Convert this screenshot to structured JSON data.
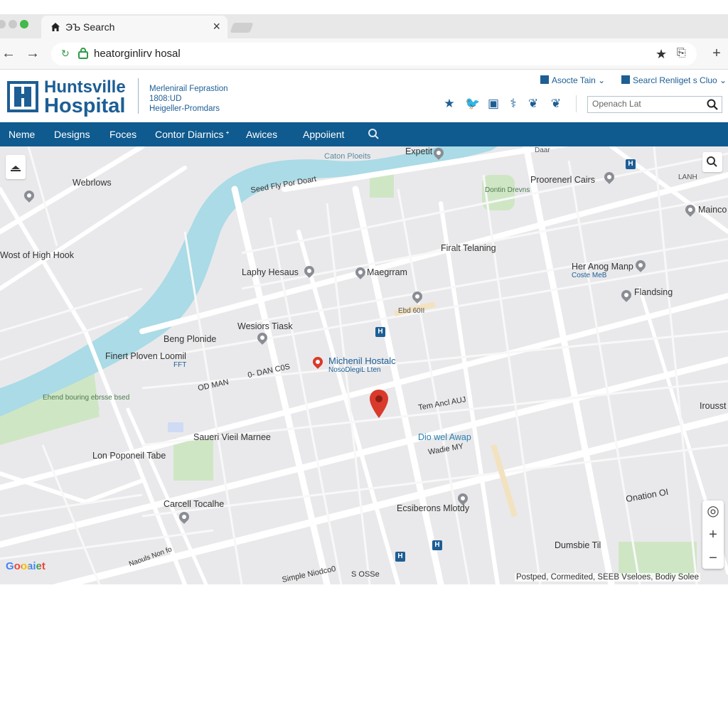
{
  "browser": {
    "tab_title": "ЭЪ Search",
    "tab_close": "×",
    "url": "heatorginlirv hosal",
    "back_icon": "back-arrow-icon",
    "forward_icon": "forward-arrow-icon",
    "back_glyph": "←",
    "forward_glyph": "→",
    "star_glyph": "★",
    "ext_glyph": "⎘",
    "plus_glyph": "+"
  },
  "site": {
    "logo_line1": "Huntsville",
    "logo_line2": "Hospital",
    "tagline": [
      "Merlenirail Feprastion",
      "1808:UD",
      "Heigeller-Promdars"
    ],
    "top_links": [
      "Asocte Tain ⌄",
      "Searcl Renliget s Cluo ⌄"
    ],
    "search_placeholder": "Openach Lat",
    "social_glyphs": [
      "★",
      "🐦",
      "▣",
      "⚕",
      "❦",
      "❦"
    ],
    "brand_color": "#1d5e95",
    "nav_color": "#0f5a8e"
  },
  "nav": {
    "items": [
      "Neme",
      "Designs",
      "Foces",
      "Contor Diarnics ᐩ",
      "Awices",
      "Appoiient"
    ]
  },
  "map": {
    "labels": [
      {
        "text": "Wost of High Hook"
      },
      {
        "text": "Webrlows"
      },
      {
        "text": "Seed Fly Por Doart"
      },
      {
        "text": "Caton Ploeits"
      },
      {
        "text": "Expetit"
      },
      {
        "text": "Proorenerl Cairs"
      },
      {
        "text": "Mainco"
      },
      {
        "text": "Laphy Hesaus"
      },
      {
        "text": "Maegrram"
      },
      {
        "text": "Firalt Telaning"
      },
      {
        "text": "Her Anog Manp"
      },
      {
        "text": "Coste MeB"
      },
      {
        "text": "Flandsing"
      },
      {
        "text": "Wesiors Tiask"
      },
      {
        "text": "Beng Plonide"
      },
      {
        "text": "Finert Ploven Loomil"
      },
      {
        "text": "FFT"
      },
      {
        "text": "Michenil Hostalc"
      },
      {
        "text": "NosoDlegiL Lten"
      },
      {
        "text": "Tem Ancl AUJ"
      },
      {
        "text": "Saueri Vieil Marnee"
      },
      {
        "text": "Dio wel Awap"
      },
      {
        "text": "Wadie MY"
      },
      {
        "text": "Lon Poponeil Tabe"
      },
      {
        "text": "Carcell Tocalhe"
      },
      {
        "text": "Ecsiberons Mlotdy"
      },
      {
        "text": "Dumsbie Til"
      },
      {
        "text": "Onation OI"
      },
      {
        "text": "Irousst"
      },
      {
        "text": "Simple Niodco0"
      },
      {
        "text": "S OSSe"
      },
      {
        "text": "Naouls Non fo"
      },
      {
        "text": "OD MAN"
      },
      {
        "text": "0- DAN C0S"
      },
      {
        "text": "Ebd 60II"
      },
      {
        "text": "LANH"
      },
      {
        "text": "Daar"
      },
      {
        "text": "Dontin Drevns"
      },
      {
        "text": "Ehend bouring ebrsse bsed"
      }
    ],
    "google_logo": "Gooaiet",
    "attribution": "Postped, Cormedited, SEEB Vseloes, Bodiy Solee",
    "zoom_in": "+",
    "zoom_out": "−",
    "locate_glyph": "◎",
    "water_color": "#aadbe6",
    "park_color": "#cfe6c5",
    "pin_color": "#d93a2b"
  }
}
